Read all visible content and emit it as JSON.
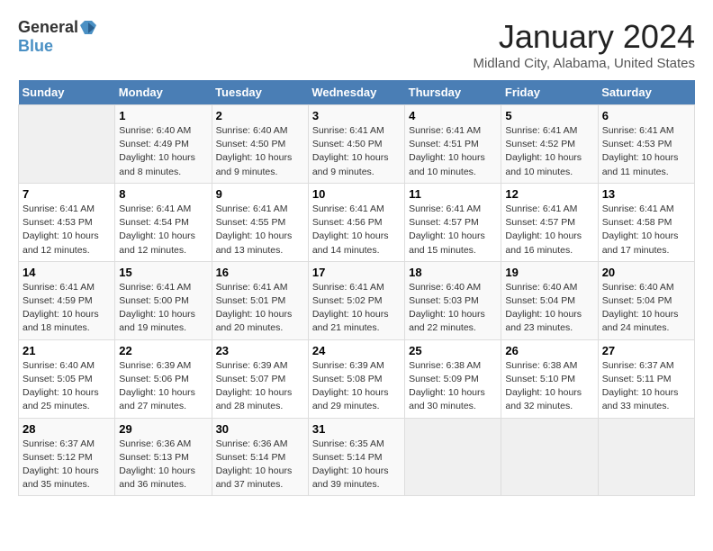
{
  "header": {
    "logo_general": "General",
    "logo_blue": "Blue",
    "month": "January 2024",
    "location": "Midland City, Alabama, United States"
  },
  "calendar": {
    "weekdays": [
      "Sunday",
      "Monday",
      "Tuesday",
      "Wednesday",
      "Thursday",
      "Friday",
      "Saturday"
    ],
    "weeks": [
      [
        {
          "day": "",
          "info": ""
        },
        {
          "day": "1",
          "info": "Sunrise: 6:40 AM\nSunset: 4:49 PM\nDaylight: 10 hours\nand 8 minutes."
        },
        {
          "day": "2",
          "info": "Sunrise: 6:40 AM\nSunset: 4:50 PM\nDaylight: 10 hours\nand 9 minutes."
        },
        {
          "day": "3",
          "info": "Sunrise: 6:41 AM\nSunset: 4:50 PM\nDaylight: 10 hours\nand 9 minutes."
        },
        {
          "day": "4",
          "info": "Sunrise: 6:41 AM\nSunset: 4:51 PM\nDaylight: 10 hours\nand 10 minutes."
        },
        {
          "day": "5",
          "info": "Sunrise: 6:41 AM\nSunset: 4:52 PM\nDaylight: 10 hours\nand 10 minutes."
        },
        {
          "day": "6",
          "info": "Sunrise: 6:41 AM\nSunset: 4:53 PM\nDaylight: 10 hours\nand 11 minutes."
        }
      ],
      [
        {
          "day": "7",
          "info": "Sunrise: 6:41 AM\nSunset: 4:53 PM\nDaylight: 10 hours\nand 12 minutes."
        },
        {
          "day": "8",
          "info": "Sunrise: 6:41 AM\nSunset: 4:54 PM\nDaylight: 10 hours\nand 12 minutes."
        },
        {
          "day": "9",
          "info": "Sunrise: 6:41 AM\nSunset: 4:55 PM\nDaylight: 10 hours\nand 13 minutes."
        },
        {
          "day": "10",
          "info": "Sunrise: 6:41 AM\nSunset: 4:56 PM\nDaylight: 10 hours\nand 14 minutes."
        },
        {
          "day": "11",
          "info": "Sunrise: 6:41 AM\nSunset: 4:57 PM\nDaylight: 10 hours\nand 15 minutes."
        },
        {
          "day": "12",
          "info": "Sunrise: 6:41 AM\nSunset: 4:57 PM\nDaylight: 10 hours\nand 16 minutes."
        },
        {
          "day": "13",
          "info": "Sunrise: 6:41 AM\nSunset: 4:58 PM\nDaylight: 10 hours\nand 17 minutes."
        }
      ],
      [
        {
          "day": "14",
          "info": "Sunrise: 6:41 AM\nSunset: 4:59 PM\nDaylight: 10 hours\nand 18 minutes."
        },
        {
          "day": "15",
          "info": "Sunrise: 6:41 AM\nSunset: 5:00 PM\nDaylight: 10 hours\nand 19 minutes."
        },
        {
          "day": "16",
          "info": "Sunrise: 6:41 AM\nSunset: 5:01 PM\nDaylight: 10 hours\nand 20 minutes."
        },
        {
          "day": "17",
          "info": "Sunrise: 6:41 AM\nSunset: 5:02 PM\nDaylight: 10 hours\nand 21 minutes."
        },
        {
          "day": "18",
          "info": "Sunrise: 6:40 AM\nSunset: 5:03 PM\nDaylight: 10 hours\nand 22 minutes."
        },
        {
          "day": "19",
          "info": "Sunrise: 6:40 AM\nSunset: 5:04 PM\nDaylight: 10 hours\nand 23 minutes."
        },
        {
          "day": "20",
          "info": "Sunrise: 6:40 AM\nSunset: 5:04 PM\nDaylight: 10 hours\nand 24 minutes."
        }
      ],
      [
        {
          "day": "21",
          "info": "Sunrise: 6:40 AM\nSunset: 5:05 PM\nDaylight: 10 hours\nand 25 minutes."
        },
        {
          "day": "22",
          "info": "Sunrise: 6:39 AM\nSunset: 5:06 PM\nDaylight: 10 hours\nand 27 minutes."
        },
        {
          "day": "23",
          "info": "Sunrise: 6:39 AM\nSunset: 5:07 PM\nDaylight: 10 hours\nand 28 minutes."
        },
        {
          "day": "24",
          "info": "Sunrise: 6:39 AM\nSunset: 5:08 PM\nDaylight: 10 hours\nand 29 minutes."
        },
        {
          "day": "25",
          "info": "Sunrise: 6:38 AM\nSunset: 5:09 PM\nDaylight: 10 hours\nand 30 minutes."
        },
        {
          "day": "26",
          "info": "Sunrise: 6:38 AM\nSunset: 5:10 PM\nDaylight: 10 hours\nand 32 minutes."
        },
        {
          "day": "27",
          "info": "Sunrise: 6:37 AM\nSunset: 5:11 PM\nDaylight: 10 hours\nand 33 minutes."
        }
      ],
      [
        {
          "day": "28",
          "info": "Sunrise: 6:37 AM\nSunset: 5:12 PM\nDaylight: 10 hours\nand 35 minutes."
        },
        {
          "day": "29",
          "info": "Sunrise: 6:36 AM\nSunset: 5:13 PM\nDaylight: 10 hours\nand 36 minutes."
        },
        {
          "day": "30",
          "info": "Sunrise: 6:36 AM\nSunset: 5:14 PM\nDaylight: 10 hours\nand 37 minutes."
        },
        {
          "day": "31",
          "info": "Sunrise: 6:35 AM\nSunset: 5:14 PM\nDaylight: 10 hours\nand 39 minutes."
        },
        {
          "day": "",
          "info": ""
        },
        {
          "day": "",
          "info": ""
        },
        {
          "day": "",
          "info": ""
        }
      ]
    ]
  }
}
